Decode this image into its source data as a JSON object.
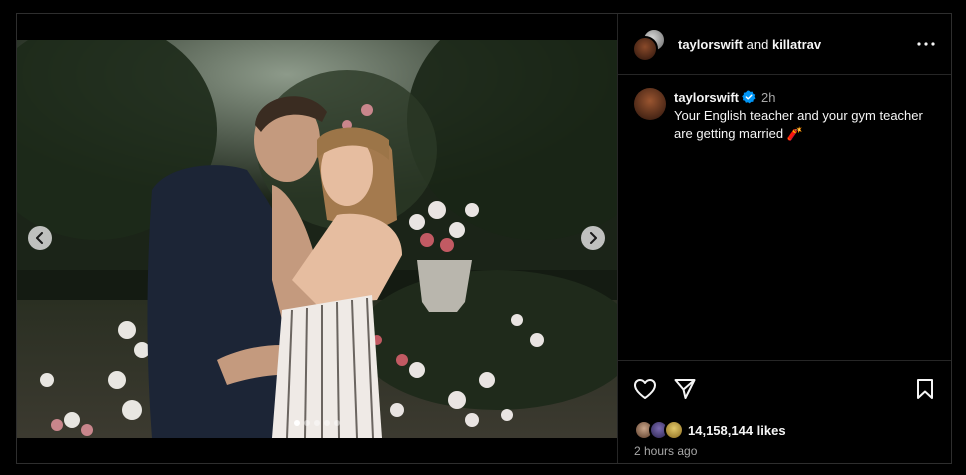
{
  "header": {
    "user1": "taylorswift",
    "joiner": "and",
    "user2": "killatrav"
  },
  "caption": {
    "username": "taylorswift",
    "time": "2h",
    "text": "Your English teacher and your gym teacher are getting married 🧨"
  },
  "footer": {
    "likes": "14,158,144 likes",
    "posted": "2 hours ago"
  },
  "carousel": {
    "slide_count": 5,
    "active_index": 0
  },
  "icons": {
    "more": "more-options-icon",
    "verified": "verified-badge-icon",
    "like": "heart-icon",
    "share": "paper-plane-icon",
    "save": "bookmark-icon",
    "prev": "chevron-left-icon",
    "next": "chevron-right-icon"
  },
  "colors": {
    "background": "#000000",
    "text": "#f5f5f5",
    "muted": "#a8a8a8",
    "divider": "#262626",
    "verified": "#0095f6"
  }
}
